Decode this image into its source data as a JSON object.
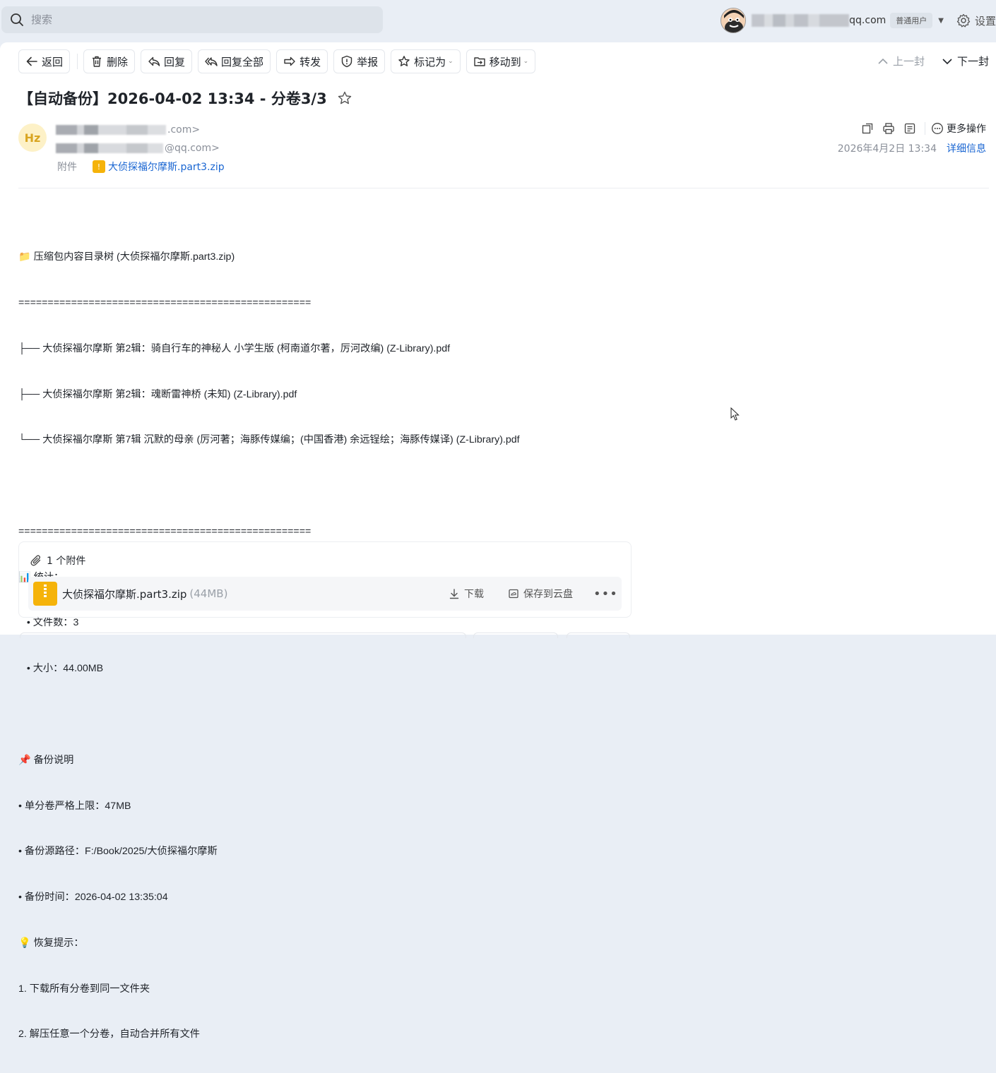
{
  "topbar": {
    "search_placeholder": "搜索",
    "user_email_domain": "qq.com",
    "user_badge": "普通用户",
    "settings_label": "设置"
  },
  "toolbar": {
    "back": "返回",
    "delete": "删除",
    "reply": "回复",
    "reply_all": "回复全部",
    "forward": "转发",
    "report": "举报",
    "mark_as": "标记为",
    "move_to": "移动到",
    "prev": "上一封",
    "next": "下一封"
  },
  "mail": {
    "subject": "【自动备份】2026-04-02 13:34 - 分卷3/3",
    "sender_initials": "Hz",
    "from_suffix": ".com>",
    "to_suffix": "@qq.com>",
    "attachment_label": "附件",
    "attachment_name": "大侦探福尔摩斯.part3.zip",
    "more_actions": "更多操作",
    "date": "2026年4月2日 13:34",
    "details": "详细信息"
  },
  "body_lines": [
    "📁 压缩包内容目录树 (大侦探福尔摩斯.part3.zip)",
    "==================================================",
    "├── 大侦探福尔摩斯 第2辑：骑自行车的神秘人 小学生版 (柯南道尔著，厉河改编) (Z-Library).pdf",
    "├── 大侦探福尔摩斯 第2辑：魂断雷神桥 (未知) (Z-Library).pdf",
    "└── 大侦探福尔摩斯 第7辑 沉默的母亲 (厉河著；海豚传媒编；(中国香港) 余远锃绘；海豚传媒译) (Z-Library).pdf",
    "",
    "==================================================",
    "📊 统计：",
    "   • 文件数：3",
    "   • 大小：44.00MB",
    "",
    "📌 备份说明",
    "• 单分卷严格上限：47MB",
    "• 备份源路径：F:/Book/2025/大侦探福尔摩斯",
    "• 备份时间：2026-04-02 13:35:04",
    "💡 恢复提示：",
    "1. 下载所有分卷到同一文件夹",
    "2. 解压任意一个分卷，自动合并所有文件"
  ],
  "attachment_panel": {
    "count_label": "1 个附件",
    "file_name": "大侦探福尔摩斯.part3.zip",
    "file_size": "(44MB)",
    "download": "下载",
    "save_cloud": "保存到云盘"
  },
  "colors": {
    "accent": "#1a66d2",
    "zip": "#f5b30a"
  }
}
